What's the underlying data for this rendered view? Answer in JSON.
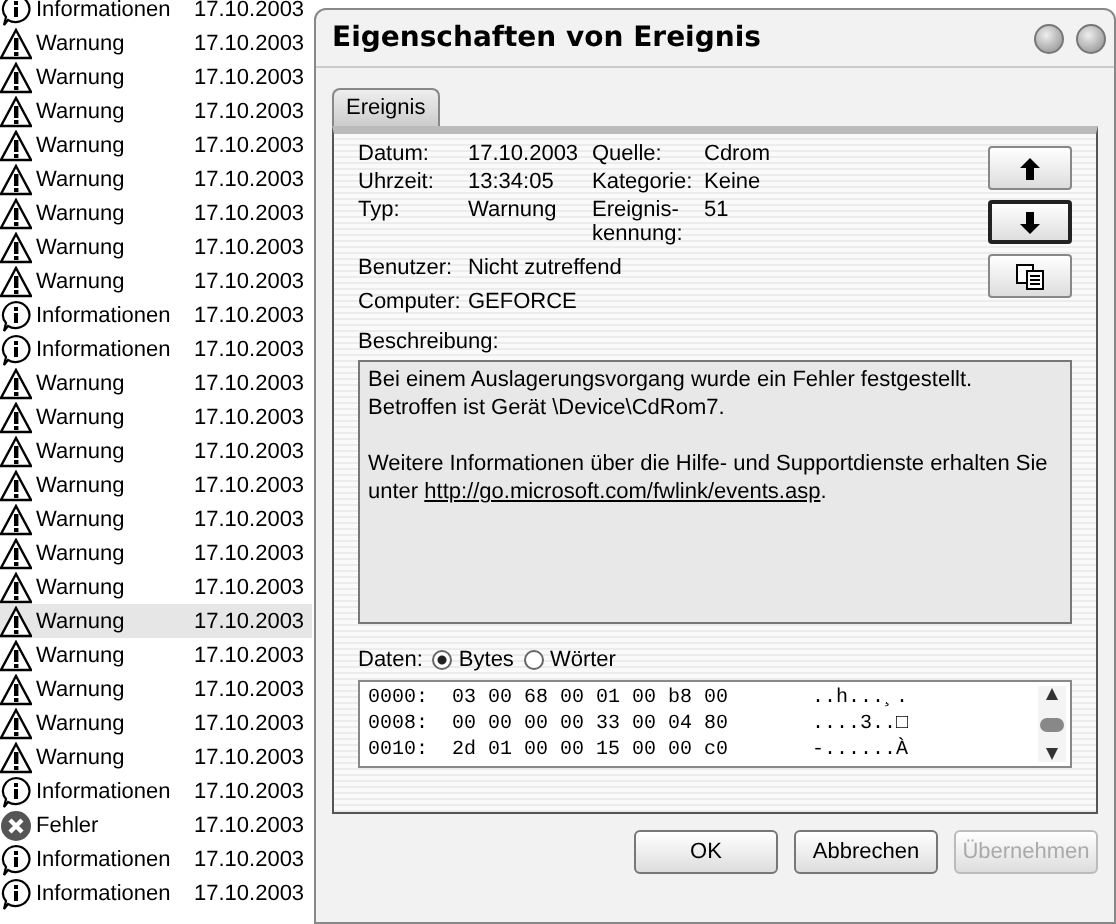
{
  "event_list": {
    "rows": [
      {
        "kind": "info",
        "type": "Informationen",
        "date": "17.10.2003",
        "selected": false
      },
      {
        "kind": "warning",
        "type": "Warnung",
        "date": "17.10.2003",
        "selected": false
      },
      {
        "kind": "warning",
        "type": "Warnung",
        "date": "17.10.2003",
        "selected": false
      },
      {
        "kind": "warning",
        "type": "Warnung",
        "date": "17.10.2003",
        "selected": false
      },
      {
        "kind": "warning",
        "type": "Warnung",
        "date": "17.10.2003",
        "selected": false
      },
      {
        "kind": "warning",
        "type": "Warnung",
        "date": "17.10.2003",
        "selected": false
      },
      {
        "kind": "warning",
        "type": "Warnung",
        "date": "17.10.2003",
        "selected": false
      },
      {
        "kind": "warning",
        "type": "Warnung",
        "date": "17.10.2003",
        "selected": false
      },
      {
        "kind": "warning",
        "type": "Warnung",
        "date": "17.10.2003",
        "selected": false
      },
      {
        "kind": "info",
        "type": "Informationen",
        "date": "17.10.2003",
        "selected": false
      },
      {
        "kind": "info",
        "type": "Informationen",
        "date": "17.10.2003",
        "selected": false
      },
      {
        "kind": "warning",
        "type": "Warnung",
        "date": "17.10.2003",
        "selected": false
      },
      {
        "kind": "warning",
        "type": "Warnung",
        "date": "17.10.2003",
        "selected": false
      },
      {
        "kind": "warning",
        "type": "Warnung",
        "date": "17.10.2003",
        "selected": false
      },
      {
        "kind": "warning",
        "type": "Warnung",
        "date": "17.10.2003",
        "selected": false
      },
      {
        "kind": "warning",
        "type": "Warnung",
        "date": "17.10.2003",
        "selected": false
      },
      {
        "kind": "warning",
        "type": "Warnung",
        "date": "17.10.2003",
        "selected": false
      },
      {
        "kind": "warning",
        "type": "Warnung",
        "date": "17.10.2003",
        "selected": false
      },
      {
        "kind": "warning",
        "type": "Warnung",
        "date": "17.10.2003",
        "selected": true
      },
      {
        "kind": "warning",
        "type": "Warnung",
        "date": "17.10.2003",
        "selected": false
      },
      {
        "kind": "warning",
        "type": "Warnung",
        "date": "17.10.2003",
        "selected": false
      },
      {
        "kind": "warning",
        "type": "Warnung",
        "date": "17.10.2003",
        "selected": false
      },
      {
        "kind": "warning",
        "type": "Warnung",
        "date": "17.10.2003",
        "selected": false
      },
      {
        "kind": "info",
        "type": "Informationen",
        "date": "17.10.2003",
        "selected": false
      },
      {
        "kind": "error",
        "type": "Fehler",
        "date": "17.10.2003",
        "selected": false
      },
      {
        "kind": "info",
        "type": "Informationen",
        "date": "17.10.2003",
        "selected": false
      },
      {
        "kind": "info",
        "type": "Informationen",
        "date": "17.10.2003",
        "selected": false
      }
    ]
  },
  "dialog": {
    "title": "Eigenschaften von Ereignis",
    "tabs": [
      {
        "label": "Ereignis",
        "selected": true
      }
    ],
    "details": [
      {
        "label": "Datum:",
        "value": "17.10.2003",
        "label2": "Quelle:",
        "value2": "Cdrom"
      },
      {
        "label": "Uhrzeit:",
        "value": "13:34:05",
        "label2": "Kategorie:",
        "value2": "Keine"
      },
      {
        "label": "Typ:",
        "value": "Warnung",
        "label2": "Ereignis-kennung:",
        "value2": "51"
      }
    ],
    "user": {
      "label": "Benutzer:",
      "value": "Nicht zutreffend"
    },
    "computer": {
      "label": "Computer:",
      "value": "GEFORCE"
    },
    "description_label": "Beschreibung:",
    "description": [
      "Bei einem Auslagerungsvorgang wurde ein Fehler festgestellt. Betroffen ist Gerät \\Device\\CdRom7.",
      "Weitere Informationen über die Hilfe- und Supportdienste erhalten Sie unter "
    ],
    "description_link": "http://go.microsoft.com/fwlink/events.asp",
    "description_end": ".",
    "data_label": "Daten:",
    "data_modes": [
      {
        "label": "Bytes",
        "selected": true
      },
      {
        "label": "Wörter",
        "selected": false
      }
    ],
    "hex_rows": [
      {
        "offset": "0000:",
        "bytes": "03 00 68 00 01 00 b8 00",
        "chars": "..h...¸."
      },
      {
        "offset": "0008:",
        "bytes": "00 00 00 00 33 00 04 80",
        "chars": "....3..□"
      },
      {
        "offset": "0010:",
        "bytes": "2d 01 00 00 15 00 00 c0",
        "chars": "-......À"
      }
    ],
    "buttons": [
      {
        "label": "OK",
        "disabled": false
      },
      {
        "label": "Abbrechen",
        "disabled": false
      },
      {
        "label": "Übernehmen",
        "disabled": true
      }
    ]
  }
}
